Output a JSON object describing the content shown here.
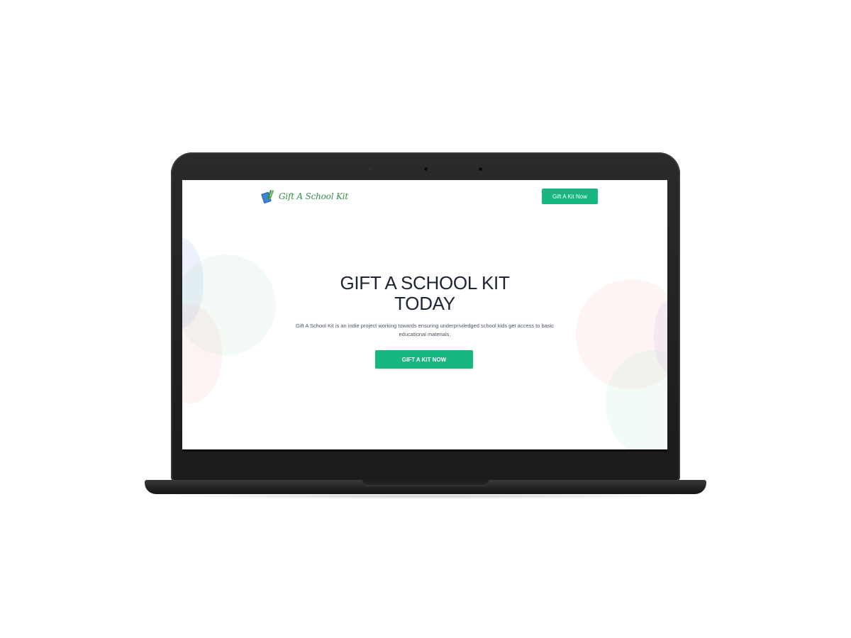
{
  "nav": {
    "logo_text": "Gift A School Kit",
    "logo_icon": "books-icon",
    "cta_label": "Gift A Kit Now"
  },
  "hero": {
    "title_line1": "GIFT A SCHOOL KIT",
    "title_line2": "TODAY",
    "description": "Gift A School Kit is an indie project working towards ensuring underpriviledged school kids get access to basic educational materials.",
    "cta_label": "GIFT A KIT NOW"
  },
  "colors": {
    "accent": "#16b880",
    "heading": "#1f2433",
    "logo_green": "#3a8c4a",
    "device_body": "#1b1b1d"
  }
}
